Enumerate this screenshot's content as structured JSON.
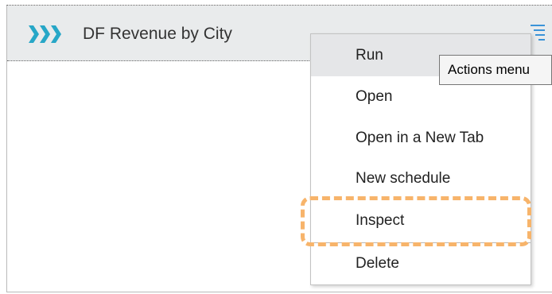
{
  "panel": {
    "title": "DF Revenue by City",
    "type_icon": "triple-chevron-icon",
    "menu_icon": "hamburger-menu-icon"
  },
  "actions_menu": {
    "items": [
      {
        "label": "Run",
        "state": "hovered"
      },
      {
        "label": "Open"
      },
      {
        "label": "Open in a New Tab"
      },
      {
        "label": "New schedule"
      },
      {
        "label": "Inspect",
        "highlighted": true
      },
      {
        "label": "Delete"
      }
    ]
  },
  "tooltip": {
    "text": "Actions menu"
  },
  "colors": {
    "header_bg": "#e9ebec",
    "type_icon": "#27a7c7",
    "menu_icon": "#3b93d8",
    "hover_bg": "#e5e6e8",
    "highlight_border": "#f7b46b"
  }
}
